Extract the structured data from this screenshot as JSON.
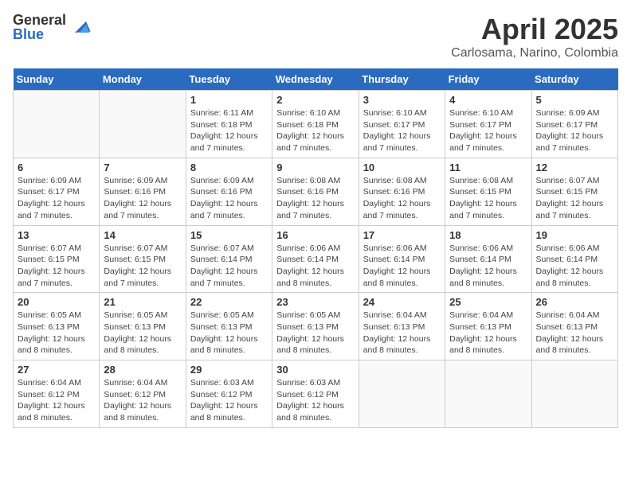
{
  "logo": {
    "general": "General",
    "blue": "Blue"
  },
  "header": {
    "title": "April 2025",
    "subtitle": "Carlosama, Narino, Colombia"
  },
  "weekdays": [
    "Sunday",
    "Monday",
    "Tuesday",
    "Wednesday",
    "Thursday",
    "Friday",
    "Saturday"
  ],
  "weeks": [
    [
      {
        "day": "",
        "info": ""
      },
      {
        "day": "",
        "info": ""
      },
      {
        "day": "1",
        "info": "Sunrise: 6:11 AM\nSunset: 6:18 PM\nDaylight: 12 hours\nand 7 minutes."
      },
      {
        "day": "2",
        "info": "Sunrise: 6:10 AM\nSunset: 6:18 PM\nDaylight: 12 hours\nand 7 minutes."
      },
      {
        "day": "3",
        "info": "Sunrise: 6:10 AM\nSunset: 6:17 PM\nDaylight: 12 hours\nand 7 minutes."
      },
      {
        "day": "4",
        "info": "Sunrise: 6:10 AM\nSunset: 6:17 PM\nDaylight: 12 hours\nand 7 minutes."
      },
      {
        "day": "5",
        "info": "Sunrise: 6:09 AM\nSunset: 6:17 PM\nDaylight: 12 hours\nand 7 minutes."
      }
    ],
    [
      {
        "day": "6",
        "info": "Sunrise: 6:09 AM\nSunset: 6:17 PM\nDaylight: 12 hours\nand 7 minutes."
      },
      {
        "day": "7",
        "info": "Sunrise: 6:09 AM\nSunset: 6:16 PM\nDaylight: 12 hours\nand 7 minutes."
      },
      {
        "day": "8",
        "info": "Sunrise: 6:09 AM\nSunset: 6:16 PM\nDaylight: 12 hours\nand 7 minutes."
      },
      {
        "day": "9",
        "info": "Sunrise: 6:08 AM\nSunset: 6:16 PM\nDaylight: 12 hours\nand 7 minutes."
      },
      {
        "day": "10",
        "info": "Sunrise: 6:08 AM\nSunset: 6:16 PM\nDaylight: 12 hours\nand 7 minutes."
      },
      {
        "day": "11",
        "info": "Sunrise: 6:08 AM\nSunset: 6:15 PM\nDaylight: 12 hours\nand 7 minutes."
      },
      {
        "day": "12",
        "info": "Sunrise: 6:07 AM\nSunset: 6:15 PM\nDaylight: 12 hours\nand 7 minutes."
      }
    ],
    [
      {
        "day": "13",
        "info": "Sunrise: 6:07 AM\nSunset: 6:15 PM\nDaylight: 12 hours\nand 7 minutes."
      },
      {
        "day": "14",
        "info": "Sunrise: 6:07 AM\nSunset: 6:15 PM\nDaylight: 12 hours\nand 7 minutes."
      },
      {
        "day": "15",
        "info": "Sunrise: 6:07 AM\nSunset: 6:14 PM\nDaylight: 12 hours\nand 7 minutes."
      },
      {
        "day": "16",
        "info": "Sunrise: 6:06 AM\nSunset: 6:14 PM\nDaylight: 12 hours\nand 8 minutes."
      },
      {
        "day": "17",
        "info": "Sunrise: 6:06 AM\nSunset: 6:14 PM\nDaylight: 12 hours\nand 8 minutes."
      },
      {
        "day": "18",
        "info": "Sunrise: 6:06 AM\nSunset: 6:14 PM\nDaylight: 12 hours\nand 8 minutes."
      },
      {
        "day": "19",
        "info": "Sunrise: 6:06 AM\nSunset: 6:14 PM\nDaylight: 12 hours\nand 8 minutes."
      }
    ],
    [
      {
        "day": "20",
        "info": "Sunrise: 6:05 AM\nSunset: 6:13 PM\nDaylight: 12 hours\nand 8 minutes."
      },
      {
        "day": "21",
        "info": "Sunrise: 6:05 AM\nSunset: 6:13 PM\nDaylight: 12 hours\nand 8 minutes."
      },
      {
        "day": "22",
        "info": "Sunrise: 6:05 AM\nSunset: 6:13 PM\nDaylight: 12 hours\nand 8 minutes."
      },
      {
        "day": "23",
        "info": "Sunrise: 6:05 AM\nSunset: 6:13 PM\nDaylight: 12 hours\nand 8 minutes."
      },
      {
        "day": "24",
        "info": "Sunrise: 6:04 AM\nSunset: 6:13 PM\nDaylight: 12 hours\nand 8 minutes."
      },
      {
        "day": "25",
        "info": "Sunrise: 6:04 AM\nSunset: 6:13 PM\nDaylight: 12 hours\nand 8 minutes."
      },
      {
        "day": "26",
        "info": "Sunrise: 6:04 AM\nSunset: 6:13 PM\nDaylight: 12 hours\nand 8 minutes."
      }
    ],
    [
      {
        "day": "27",
        "info": "Sunrise: 6:04 AM\nSunset: 6:12 PM\nDaylight: 12 hours\nand 8 minutes."
      },
      {
        "day": "28",
        "info": "Sunrise: 6:04 AM\nSunset: 6:12 PM\nDaylight: 12 hours\nand 8 minutes."
      },
      {
        "day": "29",
        "info": "Sunrise: 6:03 AM\nSunset: 6:12 PM\nDaylight: 12 hours\nand 8 minutes."
      },
      {
        "day": "30",
        "info": "Sunrise: 6:03 AM\nSunset: 6:12 PM\nDaylight: 12 hours\nand 8 minutes."
      },
      {
        "day": "",
        "info": ""
      },
      {
        "day": "",
        "info": ""
      },
      {
        "day": "",
        "info": ""
      }
    ]
  ]
}
